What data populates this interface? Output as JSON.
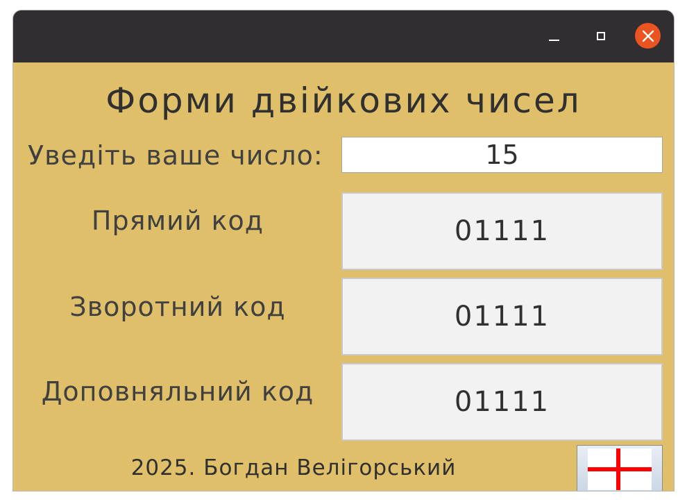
{
  "window": {
    "controls": {
      "minimize_icon": "minimize-icon",
      "maximize_icon": "maximize-icon",
      "close_icon": "close-icon",
      "close_color": "#e95420"
    },
    "background_color": "#e0bf6a",
    "titlebar_color": "#302e31"
  },
  "main": {
    "title": "Форми двійкових чисел",
    "input_label": "Уведіть ваше число:",
    "input_value": "15",
    "rows": [
      {
        "label": "Прямий код",
        "value": "01111"
      },
      {
        "label": "Зворотний код",
        "value": "01111"
      },
      {
        "label": "Доповняльний код",
        "value": "01111"
      }
    ]
  },
  "footer": {
    "text": "2025. Богдан Велігорський",
    "flag_icon": "england-flag-icon"
  }
}
